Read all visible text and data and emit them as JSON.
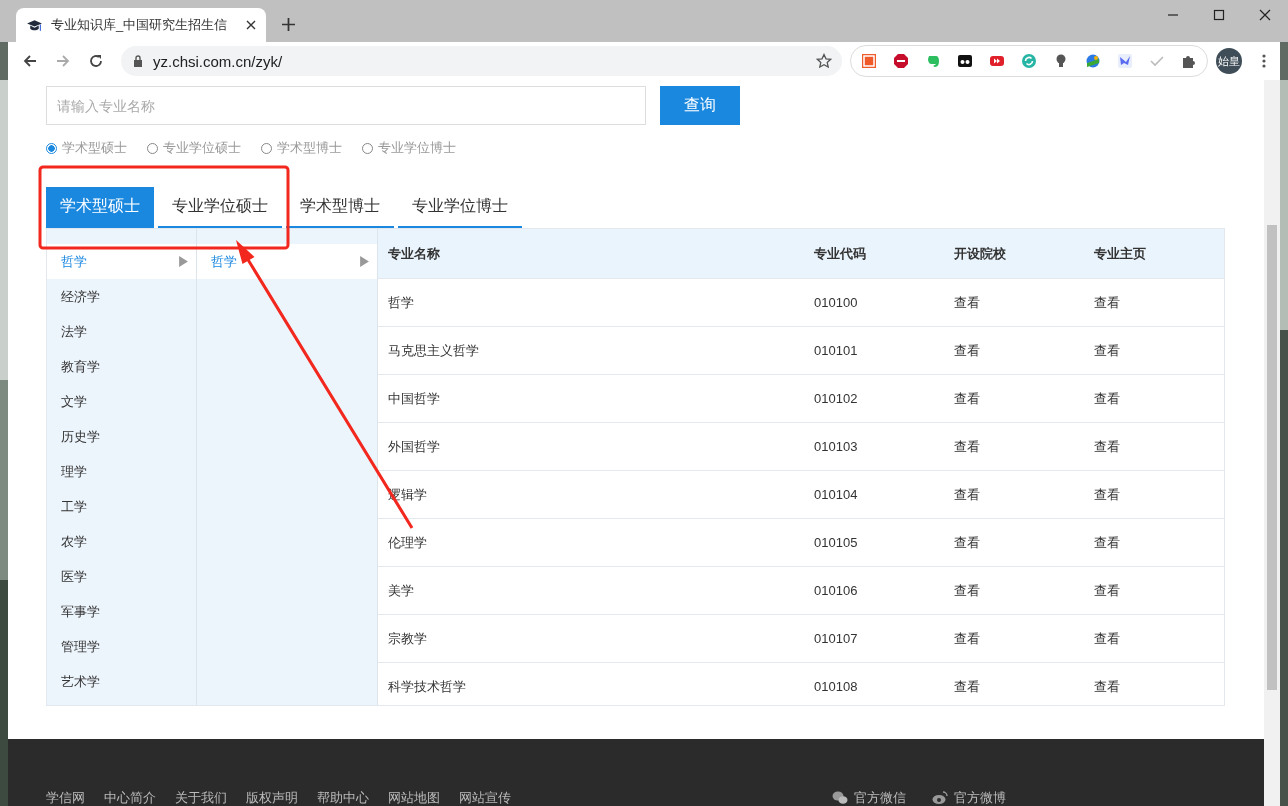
{
  "browser": {
    "tab_title": "专业知识库_中国研究生招生信",
    "url": "yz.chsi.com.cn/zyk/",
    "profile": "始皇"
  },
  "search": {
    "placeholder": "请输入专业名称",
    "button": "查询"
  },
  "degree_options": [
    {
      "label": "学术型硕士",
      "selected": true
    },
    {
      "label": "专业学位硕士",
      "selected": false
    },
    {
      "label": "学术型博士",
      "selected": false
    },
    {
      "label": "专业学位博士",
      "selected": false
    }
  ],
  "tabs": [
    {
      "label": "学术型硕士",
      "selected": true
    },
    {
      "label": "专业学位硕士",
      "selected": false
    },
    {
      "label": "学术型博士",
      "selected": false
    },
    {
      "label": "专业学位博士",
      "selected": false
    }
  ],
  "categories": [
    {
      "label": "哲学",
      "selected": true
    },
    {
      "label": "经济学",
      "selected": false
    },
    {
      "label": "法学",
      "selected": false
    },
    {
      "label": "教育学",
      "selected": false
    },
    {
      "label": "文学",
      "selected": false
    },
    {
      "label": "历史学",
      "selected": false
    },
    {
      "label": "理学",
      "selected": false
    },
    {
      "label": "工学",
      "selected": false
    },
    {
      "label": "农学",
      "selected": false
    },
    {
      "label": "医学",
      "selected": false
    },
    {
      "label": "军事学",
      "selected": false
    },
    {
      "label": "管理学",
      "selected": false
    },
    {
      "label": "艺术学",
      "selected": false
    }
  ],
  "subcategories": [
    {
      "label": "哲学",
      "selected": true
    }
  ],
  "table": {
    "columns": [
      "专业名称",
      "专业代码",
      "开设院校",
      "专业主页"
    ],
    "rows": [
      [
        "哲学",
        "010100",
        "查看",
        "查看"
      ],
      [
        "马克思主义哲学",
        "010101",
        "查看",
        "查看"
      ],
      [
        "中国哲学",
        "010102",
        "查看",
        "查看"
      ],
      [
        "外国哲学",
        "010103",
        "查看",
        "查看"
      ],
      [
        "逻辑学",
        "010104",
        "查看",
        "查看"
      ],
      [
        "伦理学",
        "010105",
        "查看",
        "查看"
      ],
      [
        "美学",
        "010106",
        "查看",
        "查看"
      ],
      [
        "宗教学",
        "010107",
        "查看",
        "查看"
      ],
      [
        "科学技术哲学",
        "010108",
        "查看",
        "查看"
      ]
    ]
  },
  "footer": {
    "links": [
      "学信网",
      "中心简介",
      "关于我们",
      "版权声明",
      "帮助中心",
      "网站地图",
      "网站宣传"
    ],
    "social": [
      {
        "label": "官方微信",
        "kind": "wechat"
      },
      {
        "label": "官方微博",
        "kind": "weibo"
      }
    ]
  }
}
